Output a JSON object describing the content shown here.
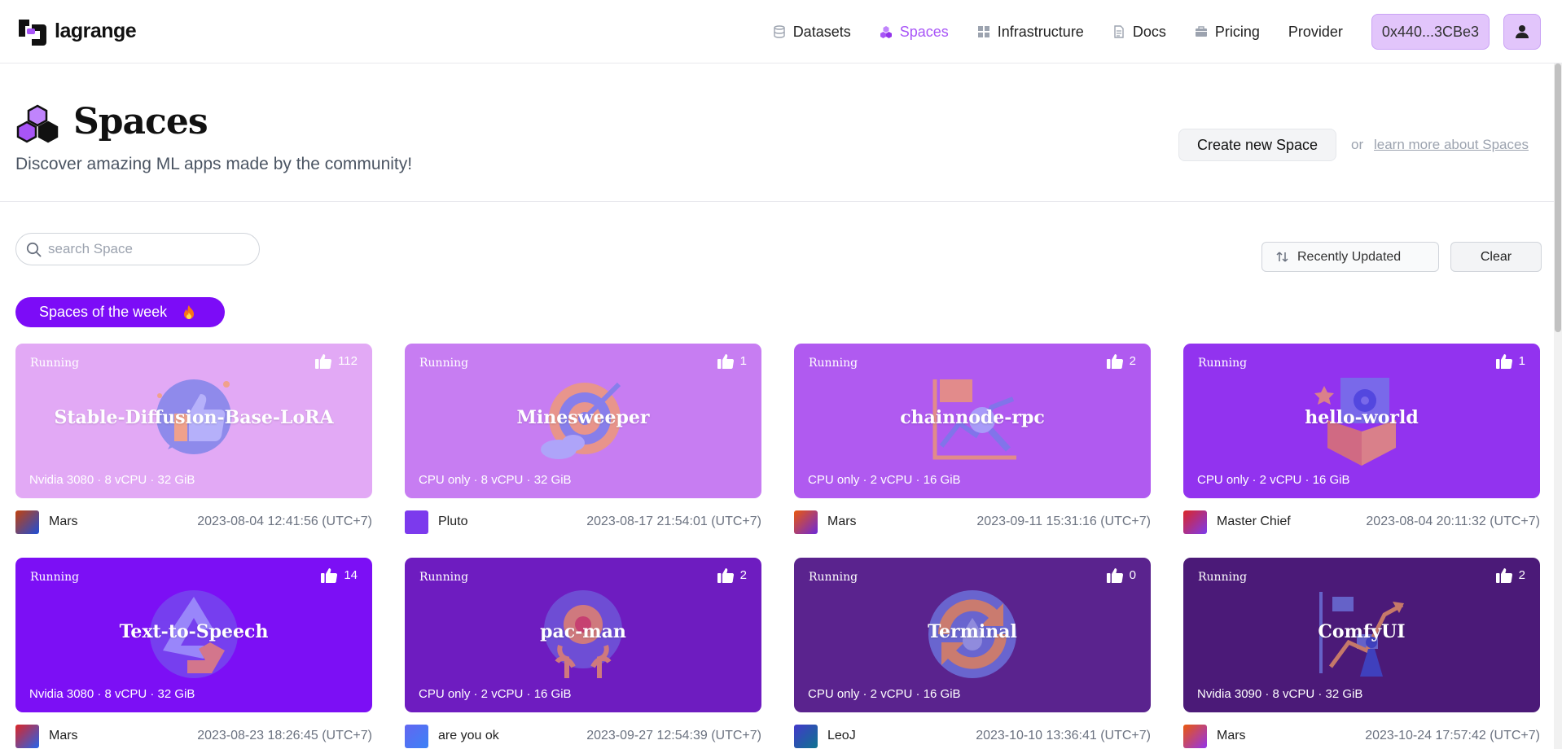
{
  "nav": {
    "logo_text": "lagrange",
    "items": [
      {
        "label": "Datasets",
        "icon": "database-icon",
        "active": false
      },
      {
        "label": "Spaces",
        "icon": "cubes-icon",
        "active": true
      },
      {
        "label": "Infrastructure",
        "icon": "grid-icon",
        "active": false
      },
      {
        "label": "Docs",
        "icon": "document-icon",
        "active": false
      },
      {
        "label": "Pricing",
        "icon": "briefcase-icon",
        "active": false
      },
      {
        "label": "Provider",
        "icon": "",
        "active": false
      }
    ],
    "wallet": "0x440...3CBe3",
    "accent": "#a855f7"
  },
  "header": {
    "title": "Spaces",
    "subtitle": "Discover amazing ML apps made by the community!",
    "create_button": "Create new Space",
    "or_text": "or",
    "learn_link": "learn more about Spaces"
  },
  "filters": {
    "search_placeholder": "search Space",
    "search_value": "",
    "sort_label": "Recently Updated",
    "clear_label": "Clear",
    "week_label": "Spaces of the week"
  },
  "cards": [
    {
      "status": "Running",
      "likes": "112",
      "title": "Stable-Diffusion-Base-LoRA",
      "hardware": "Nvidia 3080 · 8 vCPU · 32 GiB",
      "owner": "Mars",
      "updated": "2023-08-04 12:41:56 (UTC+7)",
      "bg": "#e2a9f5",
      "art": "thumb"
    },
    {
      "status": "Running",
      "likes": "1",
      "title": "Minesweeper",
      "hardware": "CPU only · 8 vCPU · 32 GiB",
      "owner": "Pluto",
      "updated": "2023-08-17 21:54:01 (UTC+7)",
      "bg": "#c77df2",
      "art": "target"
    },
    {
      "status": "Running",
      "likes": "2",
      "title": "chainnode-rpc",
      "hardware": "CPU only · 2 vCPU · 16 GiB",
      "owner": "Mars",
      "updated": "2023-09-11 15:31:16 (UTC+7)",
      "bg": "#b05af0",
      "art": "chart"
    },
    {
      "status": "Running",
      "likes": "1",
      "title": "hello-world",
      "hardware": "CPU only · 2 vCPU · 16 GiB",
      "owner": "Master Chief",
      "updated": "2023-08-04 20:11:32 (UTC+7)",
      "bg": "#9233ef",
      "art": "box"
    },
    {
      "status": "Running",
      "likes": "14",
      "title": "Text-to-Speech",
      "hardware": "Nvidia 3080 · 8 vCPU · 32 GiB",
      "owner": "Mars",
      "updated": "2023-08-23 18:26:45 (UTC+7)",
      "bg": "#7c0ff5",
      "art": "recycle"
    },
    {
      "status": "Running",
      "likes": "2",
      "title": "pac-man",
      "hardware": "CPU only · 2 vCPU · 16 GiB",
      "owner": "are you ok",
      "updated": "2023-09-27 12:54:39 (UTC+7)",
      "bg": "#6e1cc0",
      "art": "head"
    },
    {
      "status": "Running",
      "likes": "0",
      "title": "Terminal",
      "hardware": "CPU only · 2 vCPU · 16 GiB",
      "owner": "LeoJ",
      "updated": "2023-10-10 13:36:41 (UTC+7)",
      "bg": "#5a238e",
      "art": "cycle"
    },
    {
      "status": "Running",
      "likes": "2",
      "title": "ComfyUI",
      "hardware": "Nvidia 3090 · 8 vCPU · 32 GiB",
      "owner": "Mars",
      "updated": "2023-10-24 17:57:42 (UTC+7)",
      "bg": "#4b1a78",
      "art": "graph"
    }
  ],
  "owner_avatar_colors": [
    [
      "#c2410c",
      "#1d4ed8"
    ],
    [
      "#7c3aed",
      "#7c3aed"
    ],
    [
      "#ea580c",
      "#6d28d9"
    ],
    [
      "#dc2626",
      "#7c3aed"
    ],
    [
      "#dc2626",
      "#2563eb"
    ],
    [
      "#6366f1",
      "#3b82f6"
    ],
    [
      "#4338ca",
      "#0e7490"
    ],
    [
      "#ea580c",
      "#9333ea"
    ]
  ]
}
